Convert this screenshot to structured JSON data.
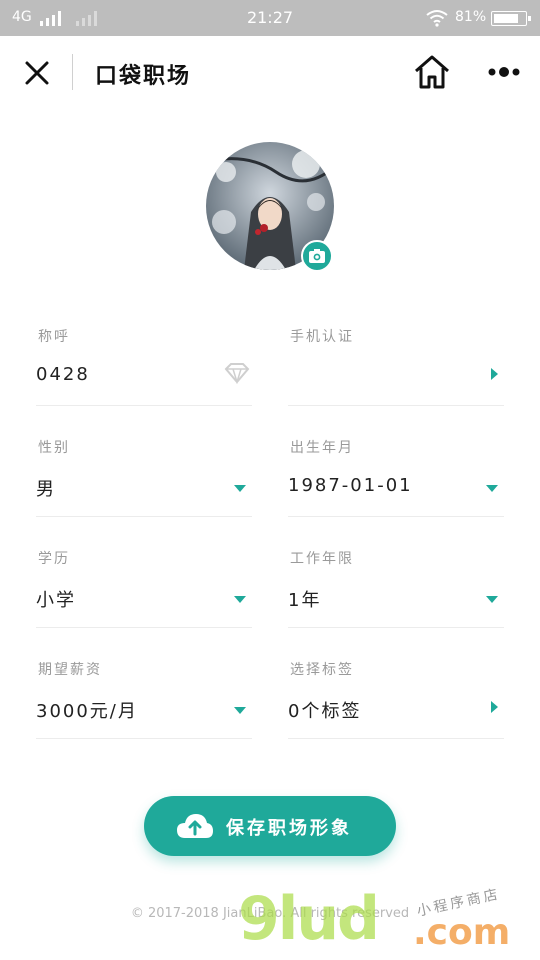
{
  "status_bar": {
    "network": "4G",
    "time": "21:27",
    "battery_percent": "81%"
  },
  "nav": {
    "title": "口袋职场",
    "close_icon": "close-icon",
    "home_icon": "home-icon",
    "more_icon": "more-icon"
  },
  "form": {
    "nickname": {
      "label": "称呼",
      "value": "0428"
    },
    "phone": {
      "label": "手机认证",
      "value": ""
    },
    "gender": {
      "label": "性别",
      "value": "男"
    },
    "birth": {
      "label": "出生年月",
      "value": "1987-01-01"
    },
    "education": {
      "label": "学历",
      "value": "小学"
    },
    "work_years": {
      "label": "工作年限",
      "value": "1年"
    },
    "salary": {
      "label": "期望薪资",
      "value": "3000元/月"
    },
    "tags": {
      "label": "选择标签",
      "value": "0个标签"
    }
  },
  "save_button": {
    "label": "保存职场形象"
  },
  "footer": {
    "text": "© 2017-2018 JianLiBao. All rights reserved"
  },
  "watermark": {
    "main": "9lud",
    "suffix": ".com",
    "sub": "小程序商店"
  },
  "colors": {
    "accent": "#1fa99a",
    "status_bar": "#bdbdbd"
  }
}
